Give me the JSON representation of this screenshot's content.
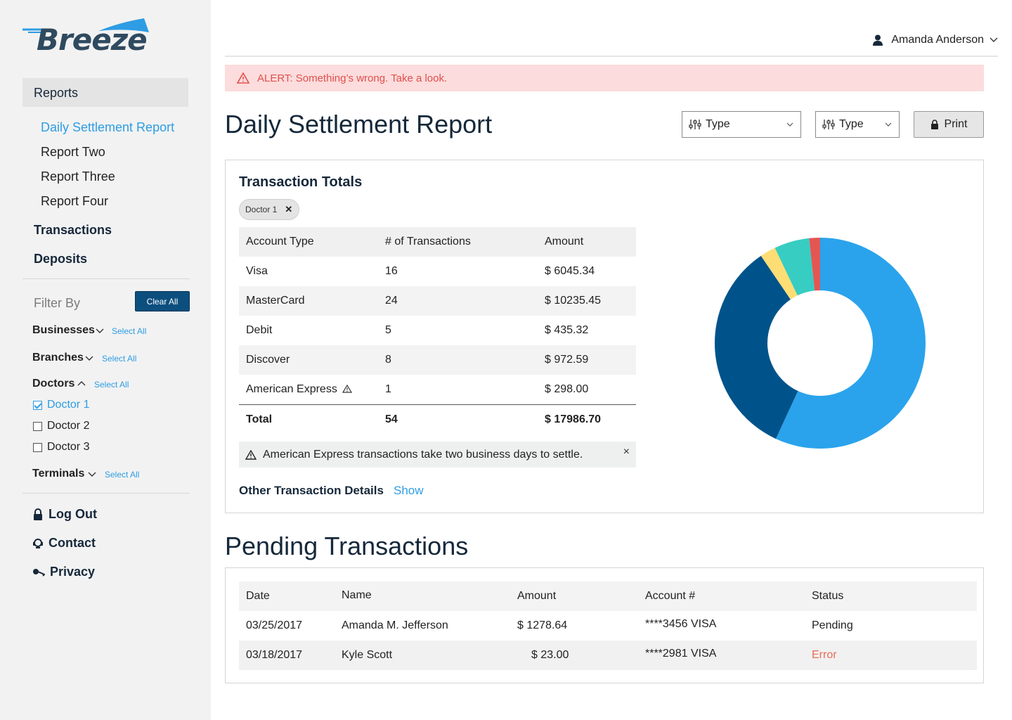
{
  "app": {
    "logo_text": "Breeze",
    "brand_color": "#2e9de4"
  },
  "sidebar": {
    "nav": [
      {
        "label": "Reports"
      },
      {
        "label": "Transactions"
      },
      {
        "label": "Deposits"
      }
    ],
    "reports_sub": [
      {
        "label": "Daily Settlement Report",
        "active": true
      },
      {
        "label": "Report Two"
      },
      {
        "label": "Report Three"
      },
      {
        "label": "Report Four"
      }
    ],
    "filter": {
      "title": "Filter By",
      "clear_all": "Clear All",
      "select_all": "Select All",
      "groups": [
        {
          "label": "Businesses",
          "expanded": false
        },
        {
          "label": "Branches",
          "expanded": false
        },
        {
          "label": "Doctors",
          "expanded": true,
          "options": [
            {
              "label": "Doctor 1",
              "checked": true
            },
            {
              "label": "Doctor 2",
              "checked": false
            },
            {
              "label": "Doctor 3",
              "checked": false
            }
          ]
        },
        {
          "label": "Terminals",
          "expanded": false
        }
      ]
    },
    "footer": [
      {
        "label": "Log Out",
        "icon": "lock-icon"
      },
      {
        "label": "Contact",
        "icon": "headset-icon"
      },
      {
        "label": "Privacy",
        "icon": "key-icon"
      }
    ]
  },
  "header": {
    "user_name": "Amanda Anderson"
  },
  "alert": {
    "text": "ALERT: Something’s wrong. Take a look.",
    "color": "#e24e4e"
  },
  "page": {
    "title": "Daily Settlement Report",
    "filters": [
      {
        "label": "Type"
      },
      {
        "label": "Type"
      }
    ],
    "print_label": "Print"
  },
  "totals": {
    "title": "Transaction Totals",
    "chip": "Doctor 1",
    "chip_close": "✕",
    "columns": [
      "Account Type",
      "# of Transactions",
      "Amount"
    ],
    "rows": [
      {
        "type": "Visa",
        "count": "16",
        "amount": "$ 6045.34"
      },
      {
        "type": "MasterCard",
        "count": "24",
        "amount": "$ 10235.45"
      },
      {
        "type": "Debit",
        "count": "5",
        "amount": "$ 435.32"
      },
      {
        "type": "Discover",
        "count": "8",
        "amount": "$ 972.59"
      },
      {
        "type": "American Express",
        "count": "1",
        "amount": "$ 298.00",
        "warning": true
      }
    ],
    "total": {
      "label": "Total",
      "count": "54",
      "amount": "$ 17986.70"
    },
    "notice": "American Express transactions take two business days to settle.",
    "notice_close": "×",
    "other_label": "Other Transaction Details",
    "other_action": "Show"
  },
  "chart_data": {
    "type": "pie",
    "donut": true,
    "categories": [
      "Visa",
      "MasterCard",
      "Debit",
      "Discover",
      "American Express"
    ],
    "values": [
      6045.34,
      10235.45,
      435.32,
      972.59,
      298.0
    ],
    "colors": [
      "#2aa3ec",
      "#00538a",
      "#fedd74",
      "#37cdc2",
      "#e45653"
    ],
    "order": "MasterCard, Visa, Debit, Discover, American Express clockwise from top (per screenshot colors: light blue, dark blue, yellow, teal, red)"
  },
  "pending": {
    "title": "Pending Transactions",
    "columns": [
      "Date",
      "Name",
      "Amount",
      "Account #",
      "Status"
    ],
    "rows": [
      {
        "date": "03/25/2017",
        "name": "Amanda M. Jefferson",
        "amount": "$ 1278.64",
        "account": "****3456 VISA",
        "status": "Pending"
      },
      {
        "date": "03/18/2017",
        "name": "Kyle Scott",
        "amount": "$ 23.00",
        "account": "****2981 VISA",
        "status": "Error"
      }
    ]
  }
}
